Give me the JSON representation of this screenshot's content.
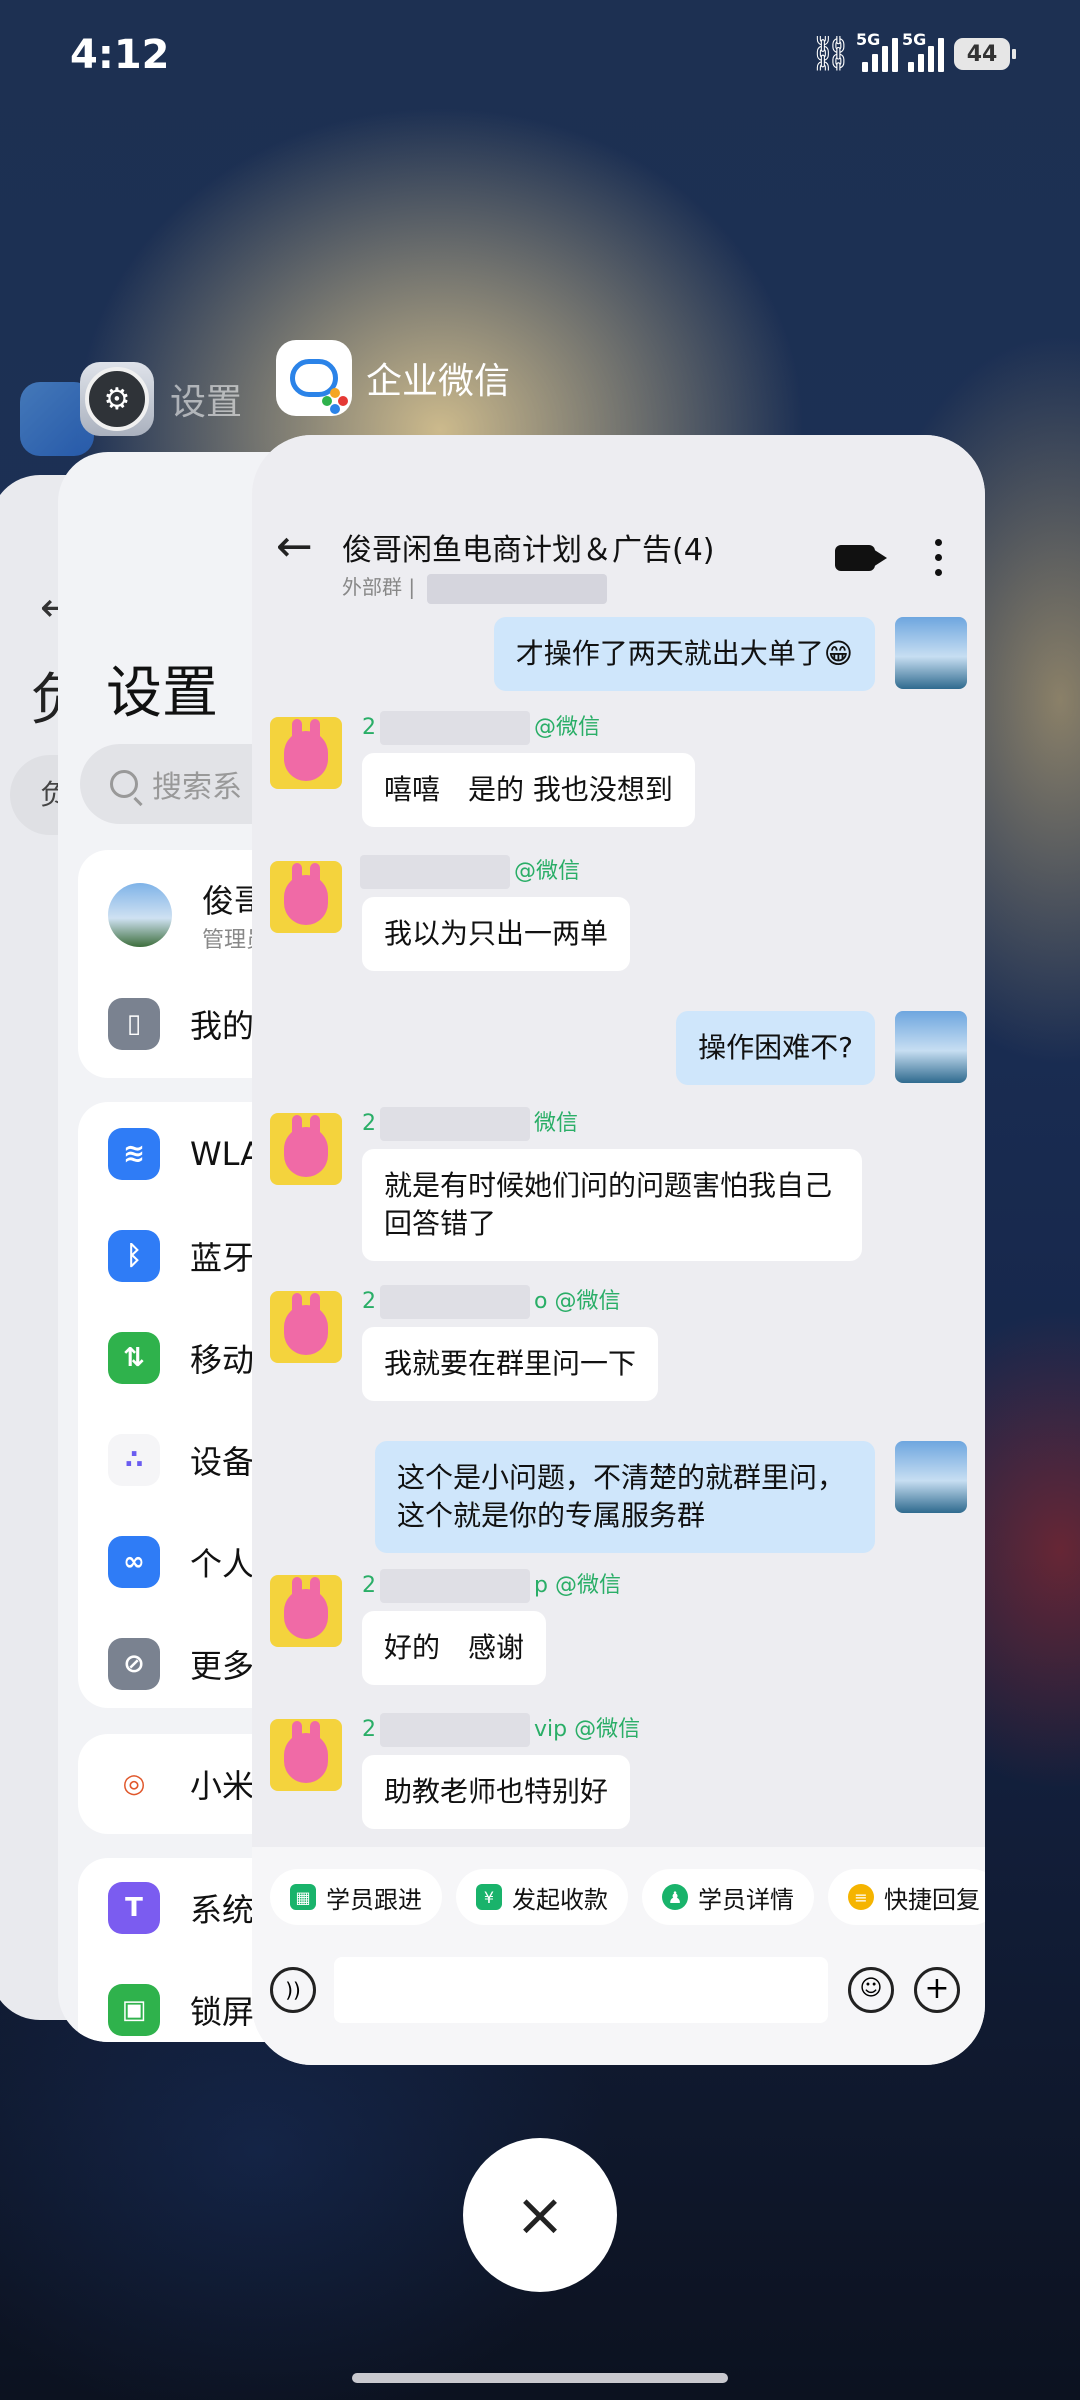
{
  "status_bar": {
    "time": "4:12",
    "net1": "5G",
    "net2": "5G",
    "battery": "44"
  },
  "back_app": {
    "arrow": "←",
    "title_char": "负",
    "pill_char": "负"
  },
  "settings_card": {
    "app_label": "设置",
    "title": "设置",
    "search_placeholder": "搜索系",
    "items": [
      {
        "label": "俊哥",
        "sub": "管理员",
        "icon": "user-avatar",
        "color": "#5b8fd9"
      },
      {
        "label": "我的",
        "icon": "phone-icon",
        "color": "#7a8290"
      },
      {
        "label": "WLA",
        "icon": "wifi-icon",
        "color": "#2f7cf6"
      },
      {
        "label": "蓝牙",
        "icon": "bluetooth-icon",
        "color": "#2f7cf6"
      },
      {
        "label": "移动",
        "icon": "mobile-data-icon",
        "color": "#2fb24c"
      },
      {
        "label": "设备",
        "icon": "device-icon",
        "color": "#f5f5f7"
      },
      {
        "label": "个人",
        "icon": "link-icon",
        "color": "#2f7cf6"
      },
      {
        "label": "更多",
        "icon": "more-connect-icon",
        "color": "#7a8290"
      },
      {
        "label": "小米",
        "icon": "xiaomi-icon",
        "color": "#ffffff"
      },
      {
        "label": "系统",
        "icon": "brush-icon",
        "color": "#7b5cf0"
      },
      {
        "label": "锁屏",
        "icon": "lock-icon",
        "color": "#2fb24c"
      }
    ]
  },
  "wechat_card": {
    "app_label": "企业微信",
    "chat_title": "俊哥闲鱼电商计划＆广告(4)",
    "chat_sub": "外部群",
    "messages": [
      {
        "side": "out",
        "text": "才操作了两天就出大单了😁"
      },
      {
        "side": "in",
        "sender_prefix": "2",
        "sender_suffix": "@微信",
        "text": "嘻嘻　是的  我也没想到"
      },
      {
        "side": "in",
        "sender_prefix": "",
        "sender_suffix": "@微信",
        "text": "我以为只出一两单"
      },
      {
        "side": "out",
        "text": "操作困难不?"
      },
      {
        "side": "in",
        "sender_prefix": "2",
        "sender_suffix": "微信",
        "text": "就是有时候她们问的问题害怕我自己回答错了"
      },
      {
        "side": "in",
        "sender_prefix": "2",
        "sender_suffix": "o @微信",
        "text": "我就要在群里问一下"
      },
      {
        "side": "out",
        "text": "这个是小问题，不清楚的就群里问，这个就是你的专属服务群"
      },
      {
        "side": "in",
        "sender_prefix": "2",
        "sender_suffix": "p @微信",
        "text": "好的　感谢"
      },
      {
        "side": "in",
        "sender_prefix": "2",
        "sender_suffix": "vip @微信",
        "text": "助教老师也特别好"
      }
    ],
    "quick_actions": [
      {
        "label": "学员跟进",
        "icon": "follow-icon",
        "color": "#19b36b"
      },
      {
        "label": "发起收款",
        "icon": "yen-icon",
        "color": "#19b36b"
      },
      {
        "label": "学员详情",
        "icon": "user-detail-icon",
        "color": "#19b36b"
      },
      {
        "label": "快捷回复",
        "icon": "quick-reply-icon",
        "color": "#f5b400"
      }
    ]
  },
  "controls": {
    "close": "×"
  }
}
